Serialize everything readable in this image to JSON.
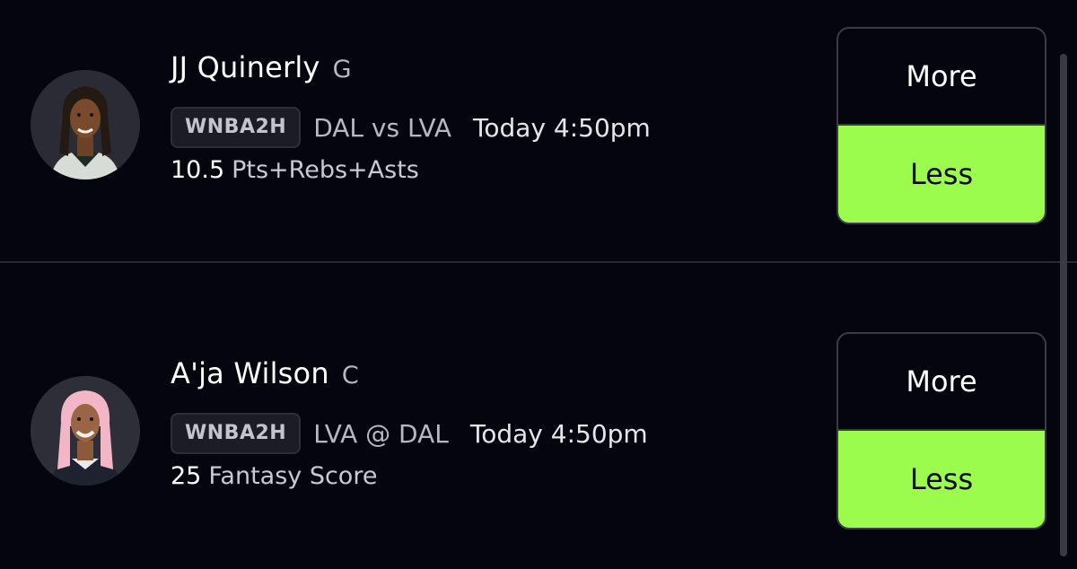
{
  "projections": [
    {
      "player_name": "JJ Quinerly",
      "position": "G",
      "league": "WNBA2H",
      "matchup": "DAL vs LVA",
      "game_time": "Today 4:50pm",
      "line_value": "10.5",
      "stat_type": "Pts+Rebs+Asts",
      "more_label": "More",
      "less_label": "Less",
      "selected": "Less"
    },
    {
      "player_name": "A'ja Wilson",
      "position": "C",
      "league": "WNBA2H",
      "matchup": "LVA @ DAL",
      "game_time": "Today 4:50pm",
      "line_value": "25",
      "stat_type": "Fantasy Score",
      "more_label": "More",
      "less_label": "Less",
      "selected": "Less"
    }
  ],
  "colors": {
    "background": "#05050f",
    "selected_pick": "#9cfc4d",
    "badge_bg": "#1c1c27",
    "divider": "#2a2a35"
  }
}
